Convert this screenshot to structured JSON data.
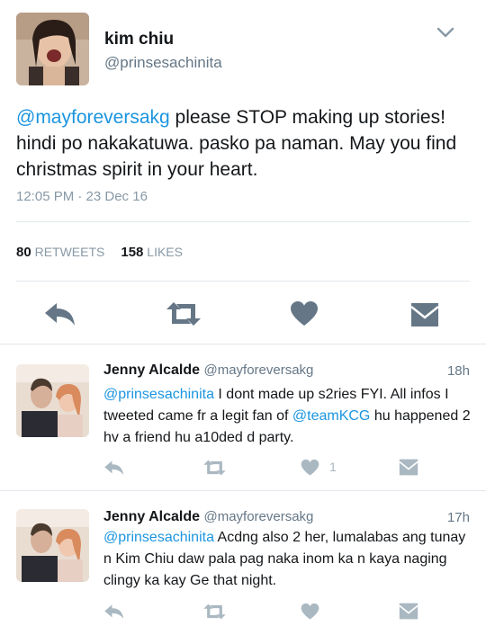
{
  "main_tweet": {
    "name": "kim chiu",
    "handle": "@prinsesachinita",
    "mention": "@mayforeversakg",
    "text": " please STOP making up stories! hindi po nakakatuwa. pasko pa naman. May you find christmas spirit in your heart.",
    "timestamp": "12:05 PM · 23 Dec 16",
    "retweets_count": "80",
    "retweets_label": "RETWEETS",
    "likes_count": "158",
    "likes_label": "LIKES"
  },
  "replies": [
    {
      "name": "Jenny Alcalde",
      "handle": "@mayforeversakg",
      "time": "18h",
      "mention": "@prinsesachinita",
      "text_1": " I dont made up s2ries FYI. All infos I tweeted came fr a legit fan of ",
      "mention_2": "@teamKCG",
      "text_2": " hu happened 2 hv a friend hu a10ded d party.",
      "like_count": "1"
    },
    {
      "name": "Jenny Alcalde",
      "handle": "@mayforeversakg",
      "time": "17h",
      "mention": "@prinsesachinita",
      "text_1": " Acdng also 2 her, lumalabas ang tunay n Kim Chiu daw pala pag naka inom ka n kaya naging clingy ka kay Ge that night."
    }
  ],
  "colors": {
    "accent": "#1b95e0",
    "icon_main": "#657786",
    "icon_reply": "#aab8c2",
    "divider": "#e1e8ed"
  },
  "icons": [
    "chevron-down-icon",
    "reply-icon",
    "retweet-icon",
    "heart-icon",
    "direct-message-icon"
  ]
}
